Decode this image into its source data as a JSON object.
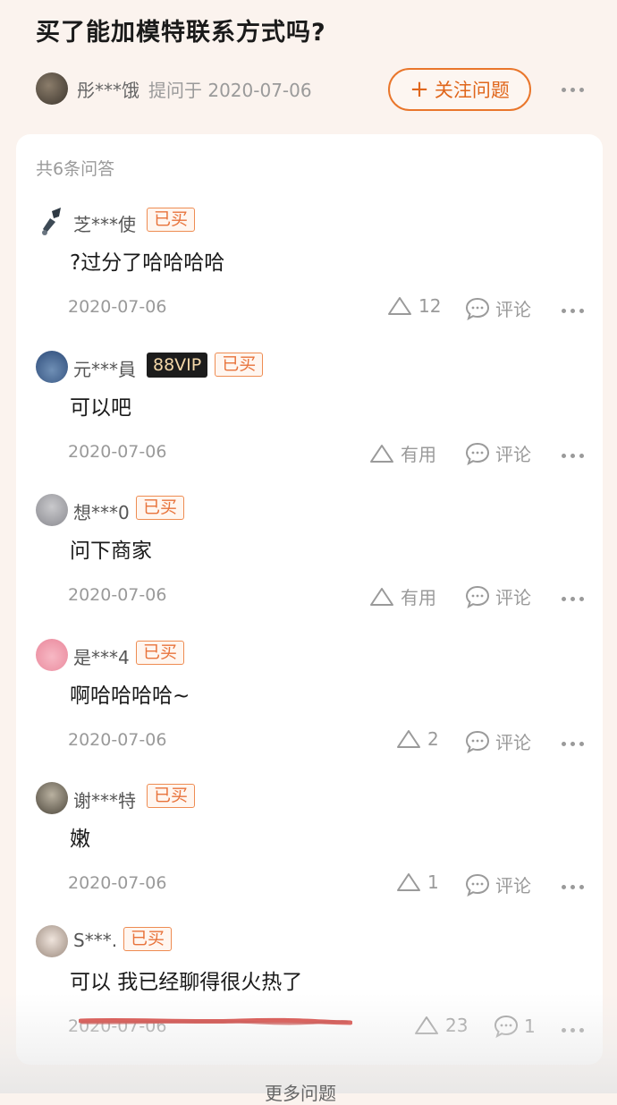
{
  "question": {
    "title": "买了能加模特联系方式吗?",
    "asker_name": "彤***饿",
    "asker_meta": "提问于 2020-07-06",
    "follow_label": "关注问题",
    "follow_icon": "plus-icon"
  },
  "answer_count": "共6条问答",
  "answers": [
    {
      "user": "芝***使",
      "vip": "",
      "bought": "已买",
      "content": "?过分了哈哈哈哈",
      "date": "2020-07-06",
      "likes": "12",
      "comments": "评论"
    },
    {
      "user": "元***員",
      "vip": "88VIP",
      "bought": "已买",
      "content": "可以吧",
      "date": "2020-07-06",
      "likes": "有用",
      "comments": "评论"
    },
    {
      "user": "想***0",
      "vip": "",
      "bought": "已买",
      "content": "问下商家",
      "date": "2020-07-06",
      "likes": "有用",
      "comments": "评论"
    },
    {
      "user": "是***4",
      "vip": "",
      "bought": "已买",
      "content": "啊哈哈哈哈~",
      "date": "2020-07-06",
      "likes": "2",
      "comments": "评论"
    },
    {
      "user": "谢***特",
      "vip": "",
      "bought": "已买",
      "content": "嫩",
      "date": "2020-07-06",
      "likes": "1",
      "comments": "评论"
    },
    {
      "user": "S***.",
      "vip": "",
      "bought": "已买",
      "content": "可以 我已经聊得很火热了",
      "date": "2020-07-06",
      "likes": "23",
      "comments": "1"
    }
  ],
  "bottom_hint": "更多问题",
  "colors": {
    "accent": "#e9762b",
    "header_bg": "#fbf3ee",
    "vip_bg": "#1c1c1c",
    "annotation_red": "#d2312b"
  }
}
